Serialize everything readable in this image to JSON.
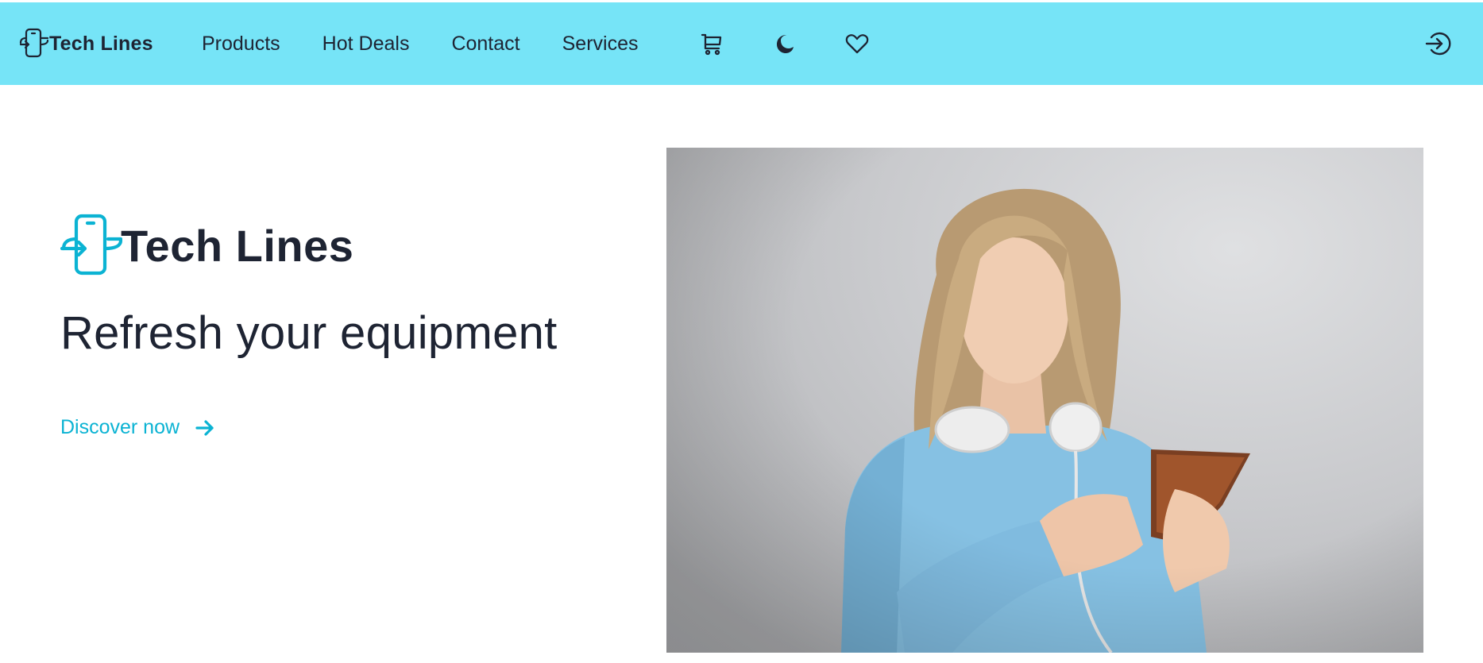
{
  "navbar": {
    "brand": {
      "name": "Tech Lines",
      "icon": "phone-swap-logo-icon"
    },
    "links": [
      {
        "label": "Products"
      },
      {
        "label": "Hot Deals"
      },
      {
        "label": "Contact"
      },
      {
        "label": "Services"
      }
    ],
    "icons": {
      "cart": "cart-icon",
      "theme": "moon-icon",
      "wishlist": "heart-icon",
      "login": "login-icon"
    },
    "background_color": "#76e4f7"
  },
  "hero": {
    "brand": "Tech Lines",
    "tagline": "Refresh your equipment",
    "cta_label": "Discover now",
    "cta_icon": "arrow-right-icon",
    "accent_color": "#0bb3d3",
    "image": {
      "subject": "woman-with-headphones-using-phone-photo"
    }
  }
}
